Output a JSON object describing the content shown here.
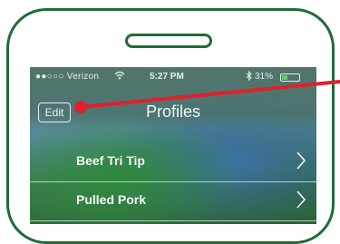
{
  "status_bar": {
    "carrier": "●●○○○ Verizon",
    "wifi_icon": "wifi-icon",
    "time": "5:27 PM",
    "bluetooth_icon": "bluetooth-icon",
    "battery_percent": "31%",
    "battery_level": 0.31,
    "battery_color": "#5dd35d"
  },
  "nav": {
    "edit_label": "Edit",
    "title": "Profiles"
  },
  "profiles": [
    {
      "label": "Beef Tri Tip"
    },
    {
      "label": "Pulled Pork"
    }
  ],
  "colors": {
    "frame": "#1f6b36",
    "annotation": "#e0202a"
  }
}
